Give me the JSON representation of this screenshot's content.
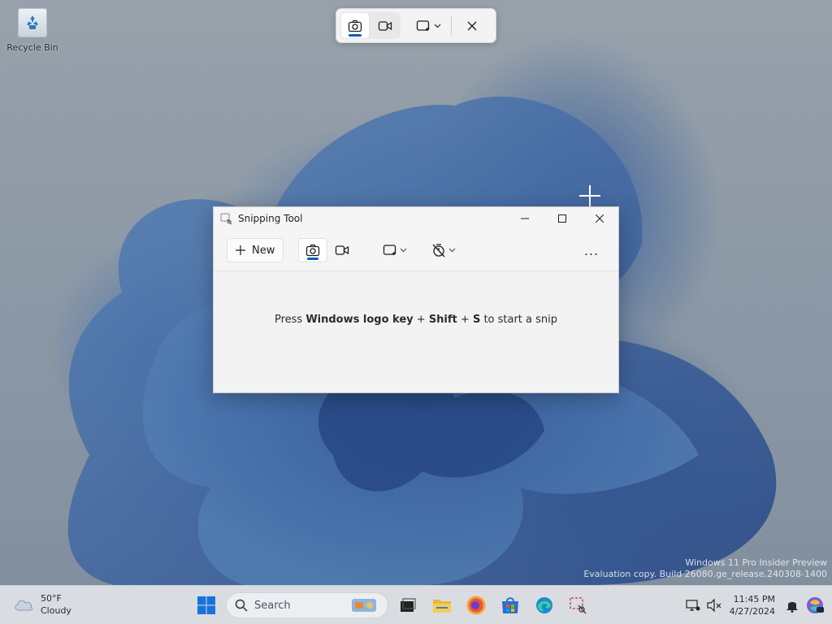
{
  "desktop": {
    "recycle_bin_label": "Recycle Bin"
  },
  "snip_toolbar": {
    "modes": [
      "Snip",
      "Record"
    ],
    "active_mode": "Snip",
    "shape_menu_icon": "rectangle-snip-icon",
    "close_icon": "close-icon"
  },
  "snipping_tool": {
    "title": "Snipping Tool",
    "new_label": "New",
    "hint_prefix": "Press ",
    "hint_key1": "Windows logo key",
    "hint_plus1": " + ",
    "hint_key2": "Shift",
    "hint_plus2": " + ",
    "hint_key3": "S",
    "hint_suffix": " to start a snip",
    "more_label": "..."
  },
  "watermark": {
    "line1": "Windows 11 Pro Insider Preview",
    "line2": "Evaluation copy. Build 26080.ge_release.240308-1400"
  },
  "taskbar": {
    "weather_temp": "50°F",
    "weather_desc": "Cloudy",
    "search_placeholder": "Search",
    "time": "11:45 PM",
    "date": "4/27/2024",
    "apps": [
      "start-icon",
      "search-icon",
      "task-view-icon",
      "file-explorer-icon",
      "firefox-icon",
      "store-icon",
      "edge-icon",
      "snipping-tool-icon"
    ]
  },
  "colors": {
    "accent": "#005fb8",
    "taskbar_bg": "#d9dde2",
    "window_bg": "#f5f5f5"
  }
}
